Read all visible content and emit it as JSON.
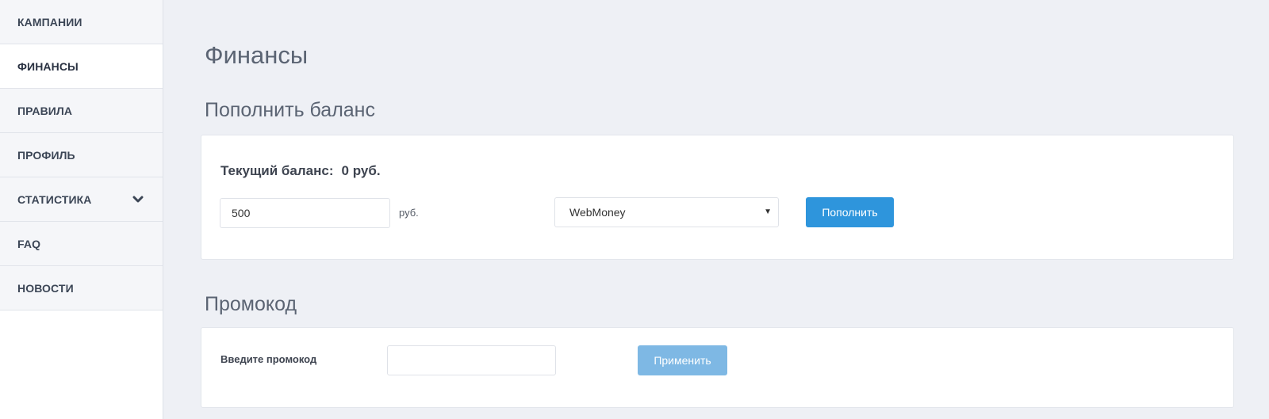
{
  "sidebar": {
    "items": [
      {
        "label": "КАМПАНИИ",
        "active": false
      },
      {
        "label": "ФИНАНСЫ",
        "active": true
      },
      {
        "label": "ПРАВИЛА",
        "active": false
      },
      {
        "label": "ПРОФИЛЬ",
        "active": false
      },
      {
        "label": "СТАТИСТИКА",
        "active": false,
        "icon": "chevron-down-icon"
      },
      {
        "label": "FAQ",
        "active": false
      },
      {
        "label": "НОВОСТИ",
        "active": false
      }
    ]
  },
  "main": {
    "page_title": "Финансы",
    "topup": {
      "section_title": "Пополнить баланс",
      "balance_label": "Текущий баланс:",
      "balance_value": "0 руб.",
      "amount_value": "500",
      "amount_unit": "руб.",
      "payment_method": "WebMoney",
      "submit_label": "Пополнить"
    },
    "promo": {
      "section_title": "Промокод",
      "field_label": "Введите промокод",
      "field_value": "",
      "apply_label": "Применить"
    }
  },
  "colors": {
    "background": "#eef0f5",
    "primary_button": "#2e95dc",
    "disabled_button": "#7eb8e4"
  }
}
